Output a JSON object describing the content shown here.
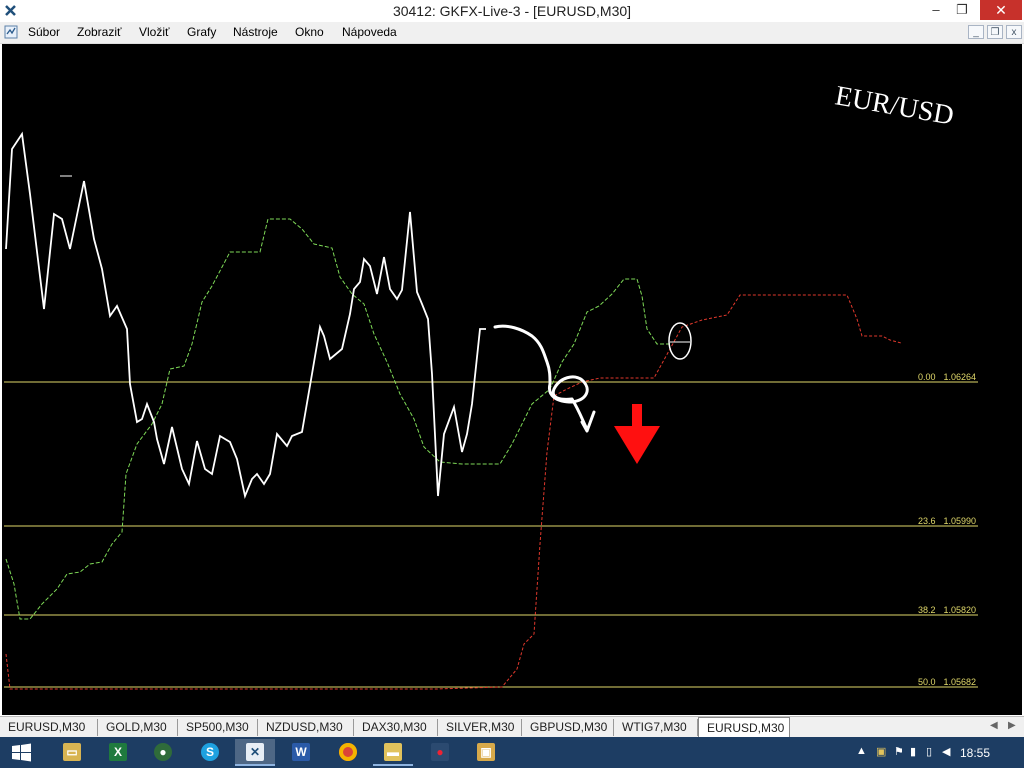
{
  "window": {
    "title": "30412: GKFX-Live-3 - [EURUSD,M30]",
    "controls": {
      "minimize": "–",
      "maximize": "❐",
      "close": "✕"
    }
  },
  "menu": {
    "items": [
      "Súbor",
      "Zobraziť",
      "Vložiť",
      "Grafy",
      "Nástroje",
      "Okno",
      "Nápoveda"
    ],
    "mdi_controls": {
      "minimize": "_",
      "restore": "❐",
      "close": "x"
    }
  },
  "chart": {
    "symbol_label": "EUR/USD",
    "background": "#000000",
    "colors": {
      "price": "#ffffff",
      "green_line": "#7ed957",
      "red_line": "#e0382c",
      "fibo": "#e0d86a",
      "arrow": "#ff1010"
    },
    "fibo_levels": [
      {
        "level": "0.00",
        "price": "1.06264"
      },
      {
        "level": "23.6",
        "price": "1.05990"
      },
      {
        "level": "38.2",
        "price": "1.05820"
      },
      {
        "level": "50.0",
        "price": "1.05682"
      }
    ],
    "annotations": [
      "white-scribble",
      "red-down-arrow",
      "white-ellipse"
    ]
  },
  "tabs": {
    "items": [
      "EURUSD,M30",
      "GOLD,M30",
      "SP500,M30",
      "NZDUSD,M30",
      "DAX30,M30",
      "SILVER,M30",
      "GBPUSD,M30",
      "WTIG7,M30",
      "EURUSD,M30"
    ],
    "active_index": 8
  },
  "taskbar": {
    "apps": [
      "file-explorer",
      "excel",
      "media",
      "skype",
      "metatrader",
      "word",
      "chrome",
      "folder",
      "app",
      "metatrader-2"
    ],
    "clock": "18:55"
  }
}
